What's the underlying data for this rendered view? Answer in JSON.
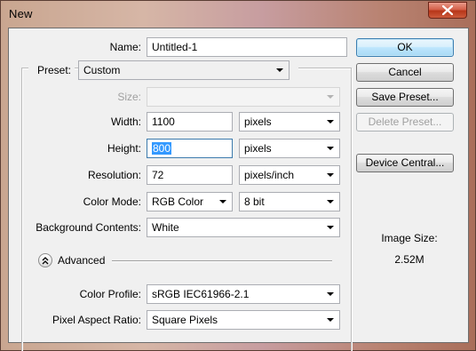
{
  "window": {
    "title": "New"
  },
  "form": {
    "name_label": "Name:",
    "name_value": "Untitled-1",
    "preset_label": "Preset:",
    "preset_value": "Custom",
    "size_label": "Size:",
    "size_value": "",
    "width_label": "Width:",
    "width_value": "1100",
    "width_unit": "pixels",
    "height_label": "Height:",
    "height_value": "800",
    "height_unit": "pixels",
    "resolution_label": "Resolution:",
    "resolution_value": "72",
    "resolution_unit": "pixels/inch",
    "color_mode_label": "Color Mode:",
    "color_mode_value": "RGB Color",
    "bit_depth_value": "8 bit",
    "background_label": "Background Contents:",
    "background_value": "White",
    "advanced_label": "Advanced",
    "color_profile_label": "Color Profile:",
    "color_profile_value": "sRGB IEC61966-2.1",
    "pixel_aspect_label": "Pixel Aspect Ratio:",
    "pixel_aspect_value": "Square Pixels"
  },
  "buttons": {
    "ok": "OK",
    "cancel": "Cancel",
    "save_preset": "Save Preset...",
    "delete_preset": "Delete Preset...",
    "device_central": "Device Central..."
  },
  "image_size": {
    "label": "Image Size:",
    "value": "2.52M"
  },
  "icons": {
    "close": "close-icon",
    "dropdown": "chevron-down-icon",
    "advanced_toggle": "double-chevron-up-icon"
  },
  "colors": {
    "selection": "#3399ff",
    "default_button_border": "#3c7fb1",
    "close_button": "#c7432a"
  }
}
